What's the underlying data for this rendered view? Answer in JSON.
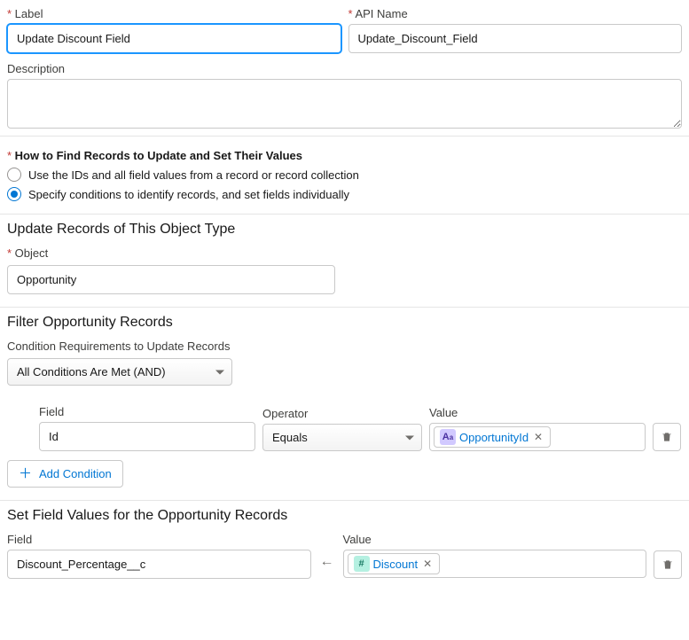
{
  "label_field": {
    "label": "Label",
    "value": "Update Discount Field"
  },
  "apiname_field": {
    "label": "API Name",
    "value": "Update_Discount_Field"
  },
  "description_field": {
    "label": "Description",
    "value": ""
  },
  "find_records": {
    "heading": "How to Find Records to Update and Set Their Values",
    "option1": "Use the IDs and all field values from a record or record collection",
    "option2": "Specify conditions to identify records, and set fields individually"
  },
  "object_section": {
    "heading": "Update Records of This Object Type",
    "label": "Object",
    "value": "Opportunity"
  },
  "filter_section": {
    "heading": "Filter Opportunity Records",
    "condition_label": "Condition Requirements to Update Records",
    "condition_value": "All Conditions Are Met (AND)",
    "cols": {
      "field": "Field",
      "operator": "Operator",
      "value": "Value"
    },
    "row": {
      "field": "Id",
      "operator": "Equals",
      "value_pill": "OpportunityId"
    },
    "add_button": "Add Condition"
  },
  "setfields_section": {
    "heading": "Set Field Values for the Opportunity Records",
    "cols": {
      "field": "Field",
      "value": "Value"
    },
    "row": {
      "field": "Discount_Percentage__c",
      "value_pill": "Discount"
    }
  }
}
